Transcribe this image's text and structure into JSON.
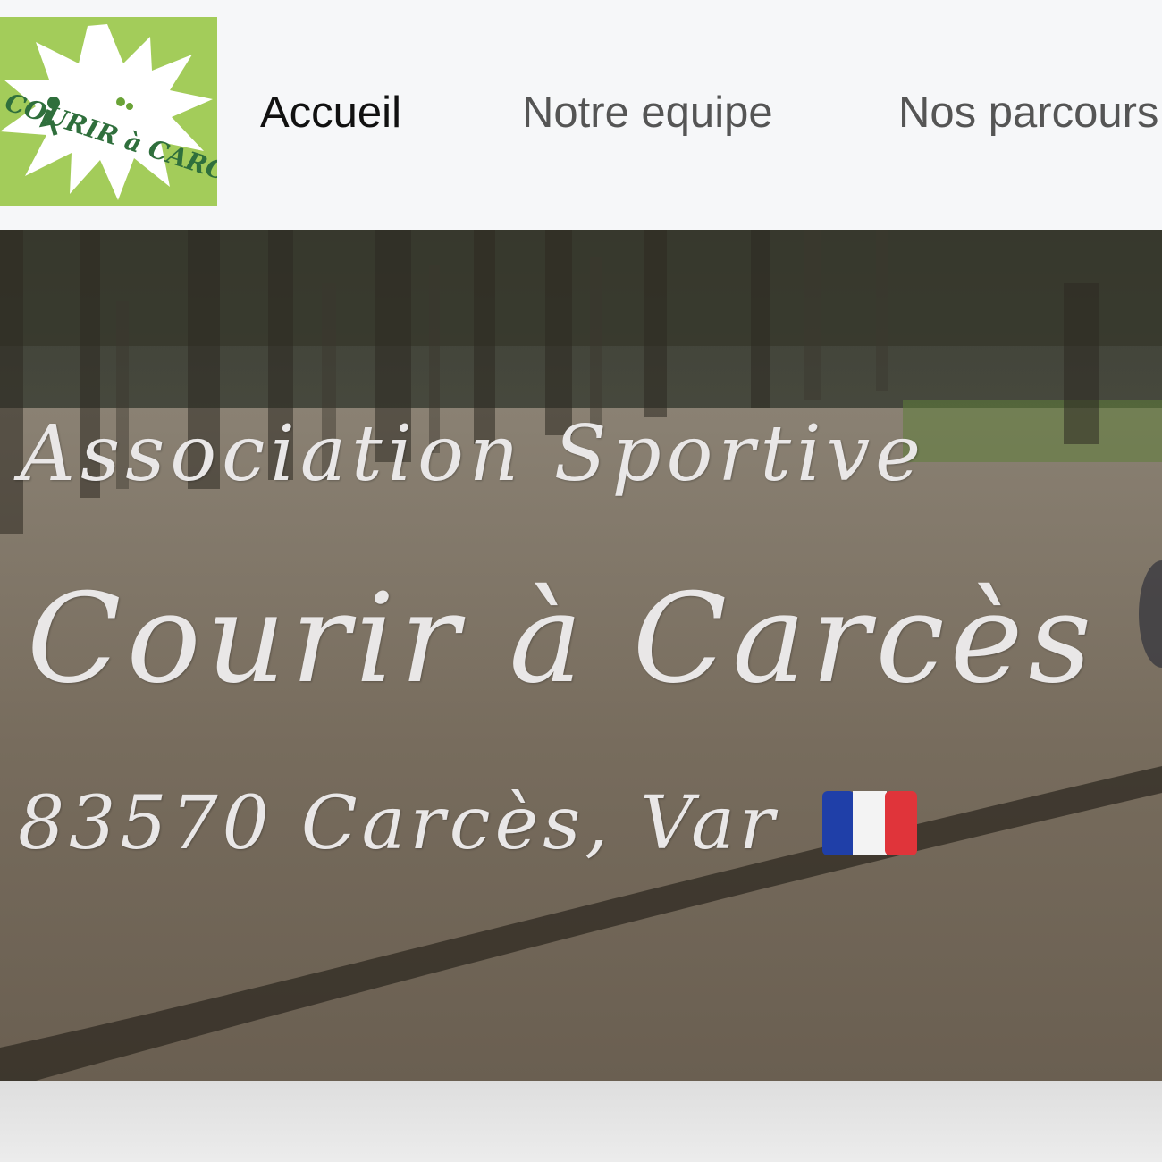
{
  "header": {
    "logo_text": "COURIR à CARCèS",
    "logo_bg": "#a3cc5a",
    "nav": {
      "items": [
        {
          "label": "Accueil",
          "active": true
        },
        {
          "label": "Notre equipe",
          "active": false
        },
        {
          "label": "Nos parcours",
          "active": false
        }
      ]
    }
  },
  "hero": {
    "subtitle": "Association Sportive",
    "title": "Courir à Carcès",
    "location": "83570 Carcès, Var",
    "flag_icon": "france-flag-icon",
    "text_color": "#e9e7e7"
  }
}
